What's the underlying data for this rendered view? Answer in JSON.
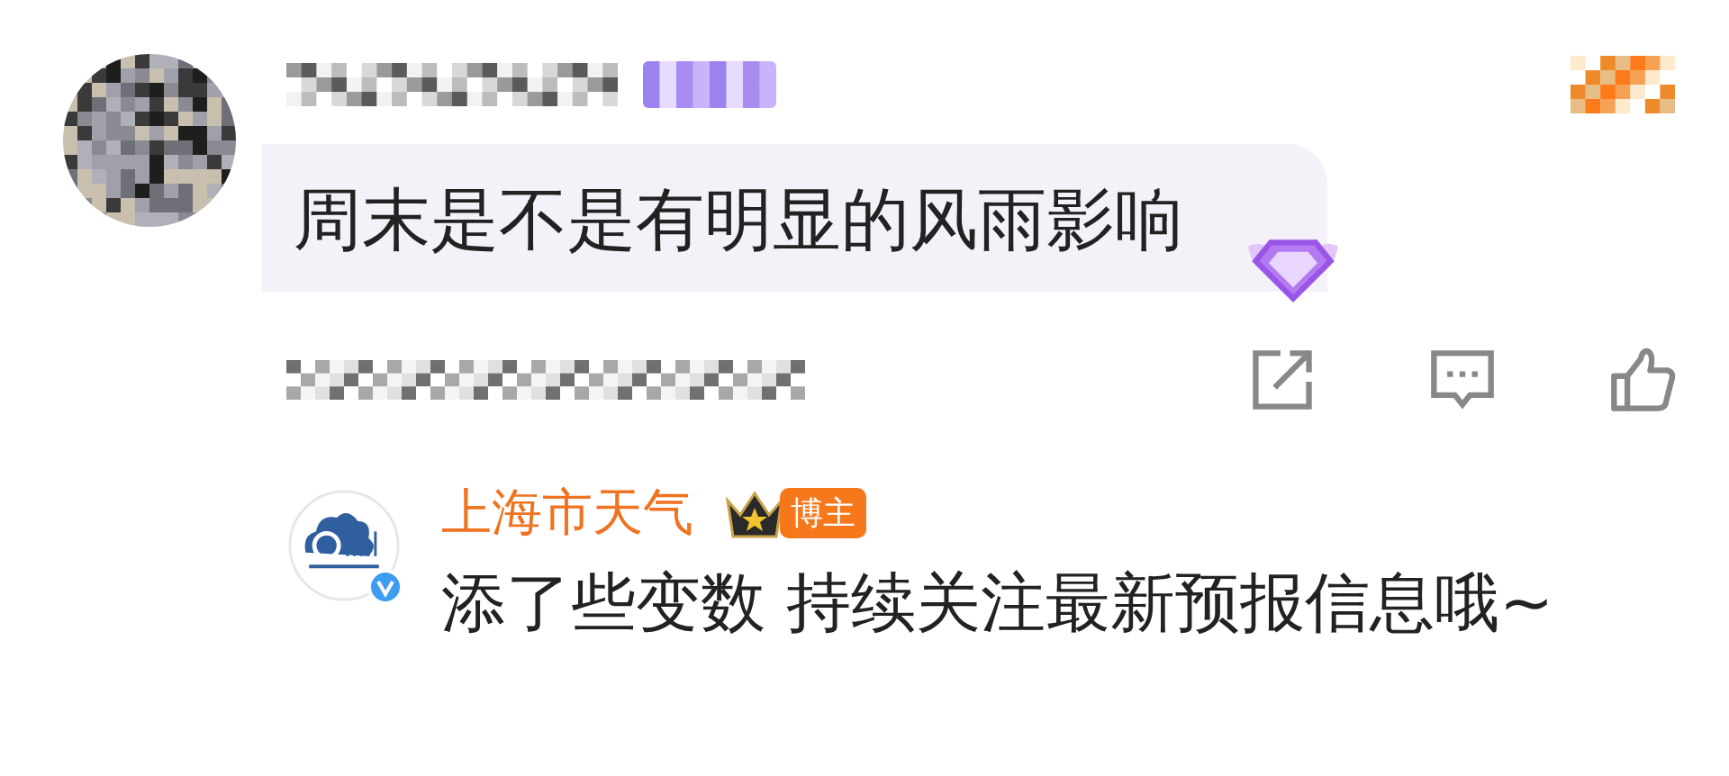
{
  "comment": {
    "text": "周末是不是有明显的风雨影响"
  },
  "reply": {
    "author": "上海市天气",
    "badge": "博主",
    "verified": true,
    "text": "添了些变数 持续关注最新预报信息哦~"
  }
}
